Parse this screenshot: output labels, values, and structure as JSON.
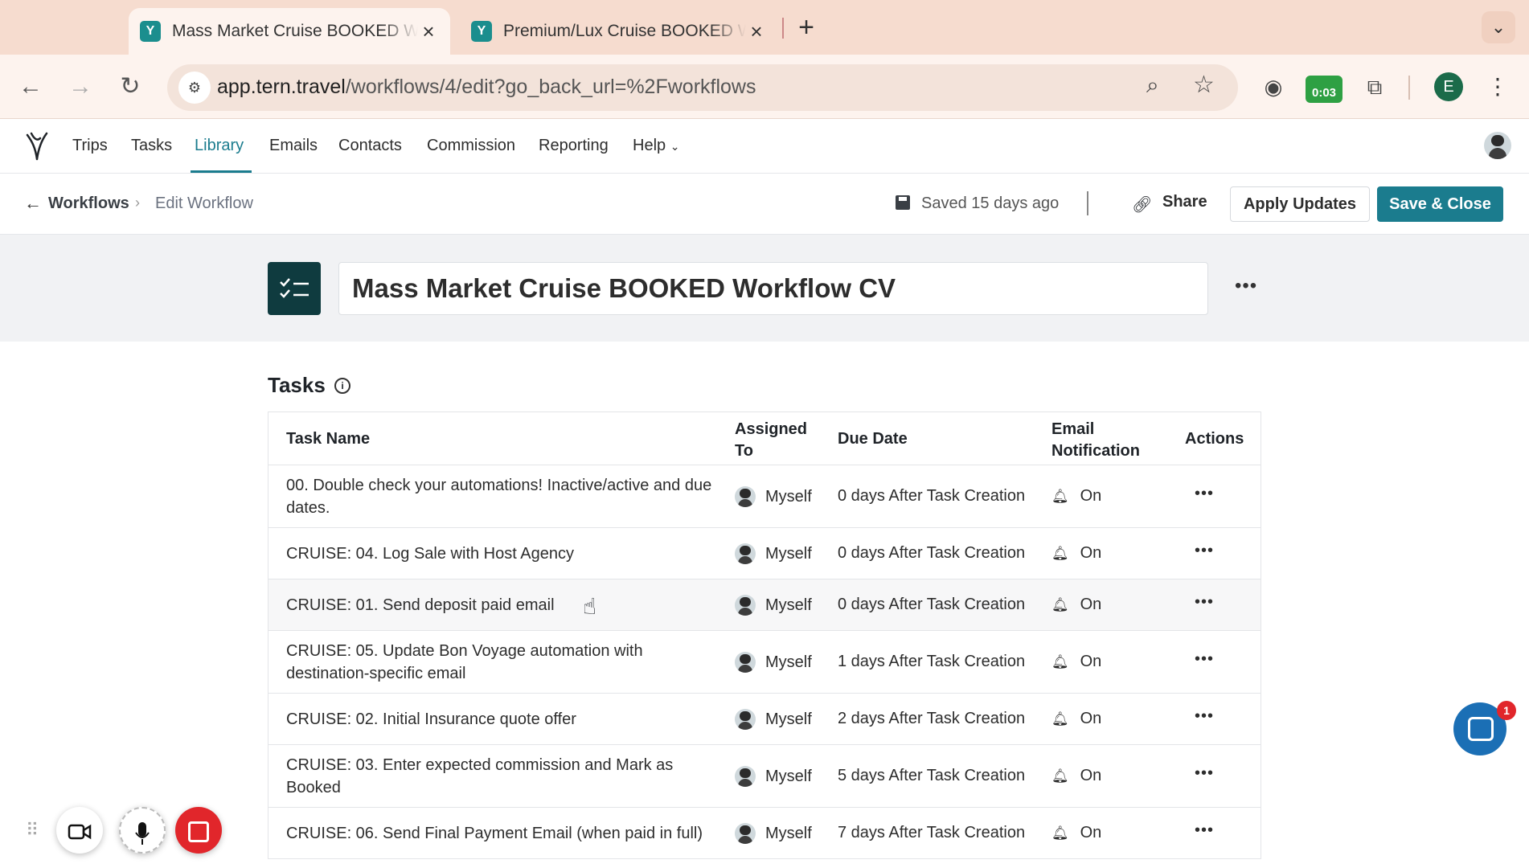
{
  "browser": {
    "tabs": [
      {
        "title": "Mass Market Cruise BOOKED Workflow CV",
        "active": true
      },
      {
        "title": "Premium/Lux Cruise BOOKED Workflow CV",
        "active": false
      }
    ],
    "url_host": "app.tern.travel",
    "url_path": "/workflows/4/edit?go_back_url=%2Fworkflows",
    "timer_badge": "0:03",
    "profile_initial": "E"
  },
  "nav": {
    "items": [
      "Trips",
      "Tasks",
      "Library",
      "Emails",
      "Contacts",
      "Commission",
      "Reporting",
      "Help"
    ],
    "active": "Library"
  },
  "header": {
    "breadcrumb_parent": "Workflows",
    "breadcrumb_current": "Edit Workflow",
    "saved_status": "Saved 15 days ago",
    "share_label": "Share",
    "apply_label": "Apply Updates",
    "save_close_label": "Save & Close"
  },
  "workflow": {
    "title": "Mass Market Cruise BOOKED Workflow CV"
  },
  "tasks": {
    "heading": "Tasks",
    "columns": {
      "name": "Task Name",
      "assigned_line1": "Assigned",
      "assigned_line2": "To",
      "due": "Due Date",
      "email_line1": "Email",
      "email_line2": "Notification",
      "actions": "Actions"
    },
    "rows": [
      {
        "name": "00. Double check your automations! Inactive/active and due dates.",
        "assigned": "Myself",
        "due": "0 days After Task Creation",
        "notification": "On"
      },
      {
        "name": "CRUISE: 04. Log Sale with Host Agency",
        "assigned": "Myself",
        "due": "0 days After Task Creation",
        "notification": "On"
      },
      {
        "name": "CRUISE: 01. Send deposit paid email",
        "assigned": "Myself",
        "due": "0 days After Task Creation",
        "notification": "On"
      },
      {
        "name": "CRUISE: 05. Update Bon Voyage automation with destination-specific email",
        "assigned": "Myself",
        "due": "1 days After Task Creation",
        "notification": "On"
      },
      {
        "name": "CRUISE: 02. Initial Insurance quote offer",
        "assigned": "Myself",
        "due": "2 days After Task Creation",
        "notification": "On"
      },
      {
        "name": "CRUISE: 03. Enter expected commission and Mark as Booked",
        "assigned": "Myself",
        "due": "5 days After Task Creation",
        "notification": "On"
      },
      {
        "name": "CRUISE: 06. Send Final Payment Email (when paid in full)",
        "assigned": "Myself",
        "due": "7 days After Task Creation",
        "notification": "On"
      }
    ]
  },
  "chat": {
    "badge_count": "1"
  },
  "colors": {
    "brand": "#1b7c8e",
    "chrome": "#f6dccf"
  }
}
